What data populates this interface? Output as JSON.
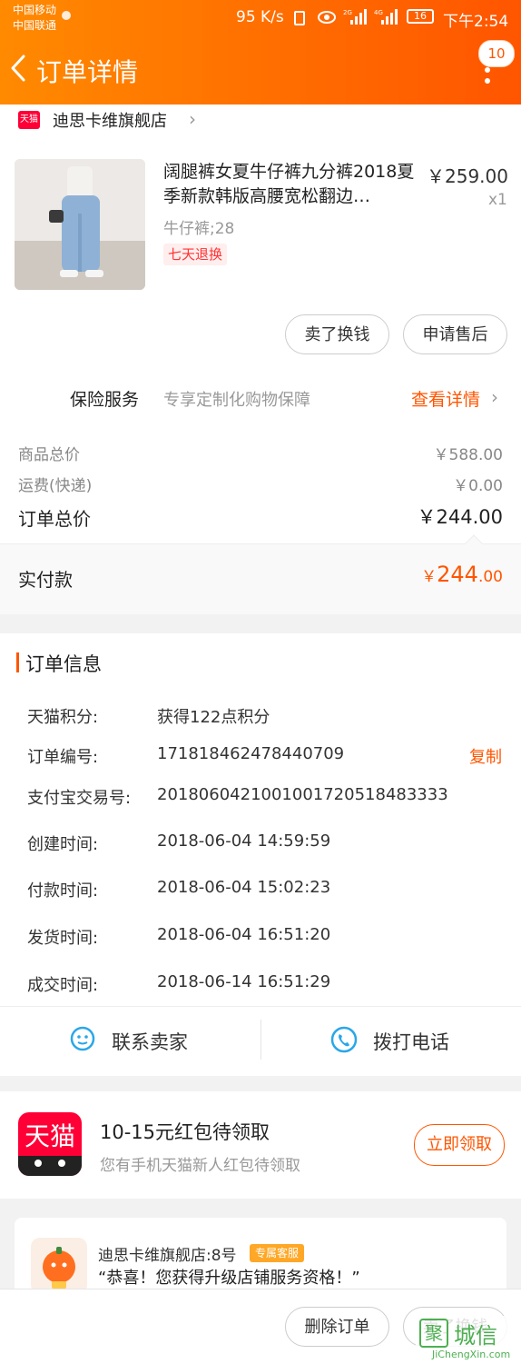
{
  "status": {
    "carrier1": "中国移动",
    "carrier2": "中国联通",
    "speed": "95 K/s",
    "battery": "16",
    "time": "下午2:54"
  },
  "header": {
    "title": "订单详情",
    "badge": "10"
  },
  "store": {
    "logo_text": "天猫",
    "name": "迪思卡维旗舰店"
  },
  "product": {
    "title": "阔腿裤女夏牛仔裤九分裤2018夏季新款韩版高腰宽松翻边…",
    "price": "￥259.00",
    "qty": "x1",
    "sku": "牛仔裤;28",
    "tag": "七天退换"
  },
  "actions": {
    "sell": "卖了换钱",
    "aftersale": "申请售后"
  },
  "insurance": {
    "label": "保险服务",
    "desc": "专享定制化购物保障",
    "link": "查看详情"
  },
  "summary": {
    "goods_label": "商品总价",
    "goods_value": "￥588.00",
    "shipping_label": "运费(快递)",
    "shipping_value": "￥0.00",
    "total_label": "订单总价",
    "total_value": "￥244.00",
    "paid_label": "实付款",
    "paid_currency": "￥",
    "paid_int": "244",
    "paid_dec": ".00"
  },
  "order_info": {
    "title": "订单信息",
    "points_label": "天猫积分:",
    "points_value": "获得122点积分",
    "order_no_label": "订单编号:",
    "order_no_value": "171818462478440709",
    "copy": "复制",
    "alipay_label": "支付宝交易号:",
    "alipay_value": "2018060421001001720518483333",
    "created_label": "创建时间:",
    "created_value": "2018-06-04 14:59:59",
    "paid_label": "付款时间:",
    "paid_value": "2018-06-04 15:02:23",
    "shipped_label": "发货时间:",
    "shipped_value": "2018-06-04 16:51:20",
    "done_label": "成交时间:",
    "done_value": "2018-06-14 16:51:29"
  },
  "contact": {
    "seller": "联系卖家",
    "phone": "拨打电话"
  },
  "red_packet": {
    "logo_text": "天猫",
    "title": "10-15元红包待领取",
    "subtitle": "您有手机天猫新人红包待领取",
    "button": "立即领取"
  },
  "service": {
    "name": "迪思卡维旗舰店:8号",
    "tag": "专属客服",
    "message": "“恭喜！您获得升级店铺服务资格！”"
  },
  "bottom": {
    "delete": "删除订单",
    "sell": "卖了换钱"
  },
  "watermark": {
    "text": "城信",
    "box": "聚",
    "sub": "JiChengXin.com"
  },
  "colors": {
    "accent": "#ff5500",
    "tmall_red": "#ff0036"
  }
}
